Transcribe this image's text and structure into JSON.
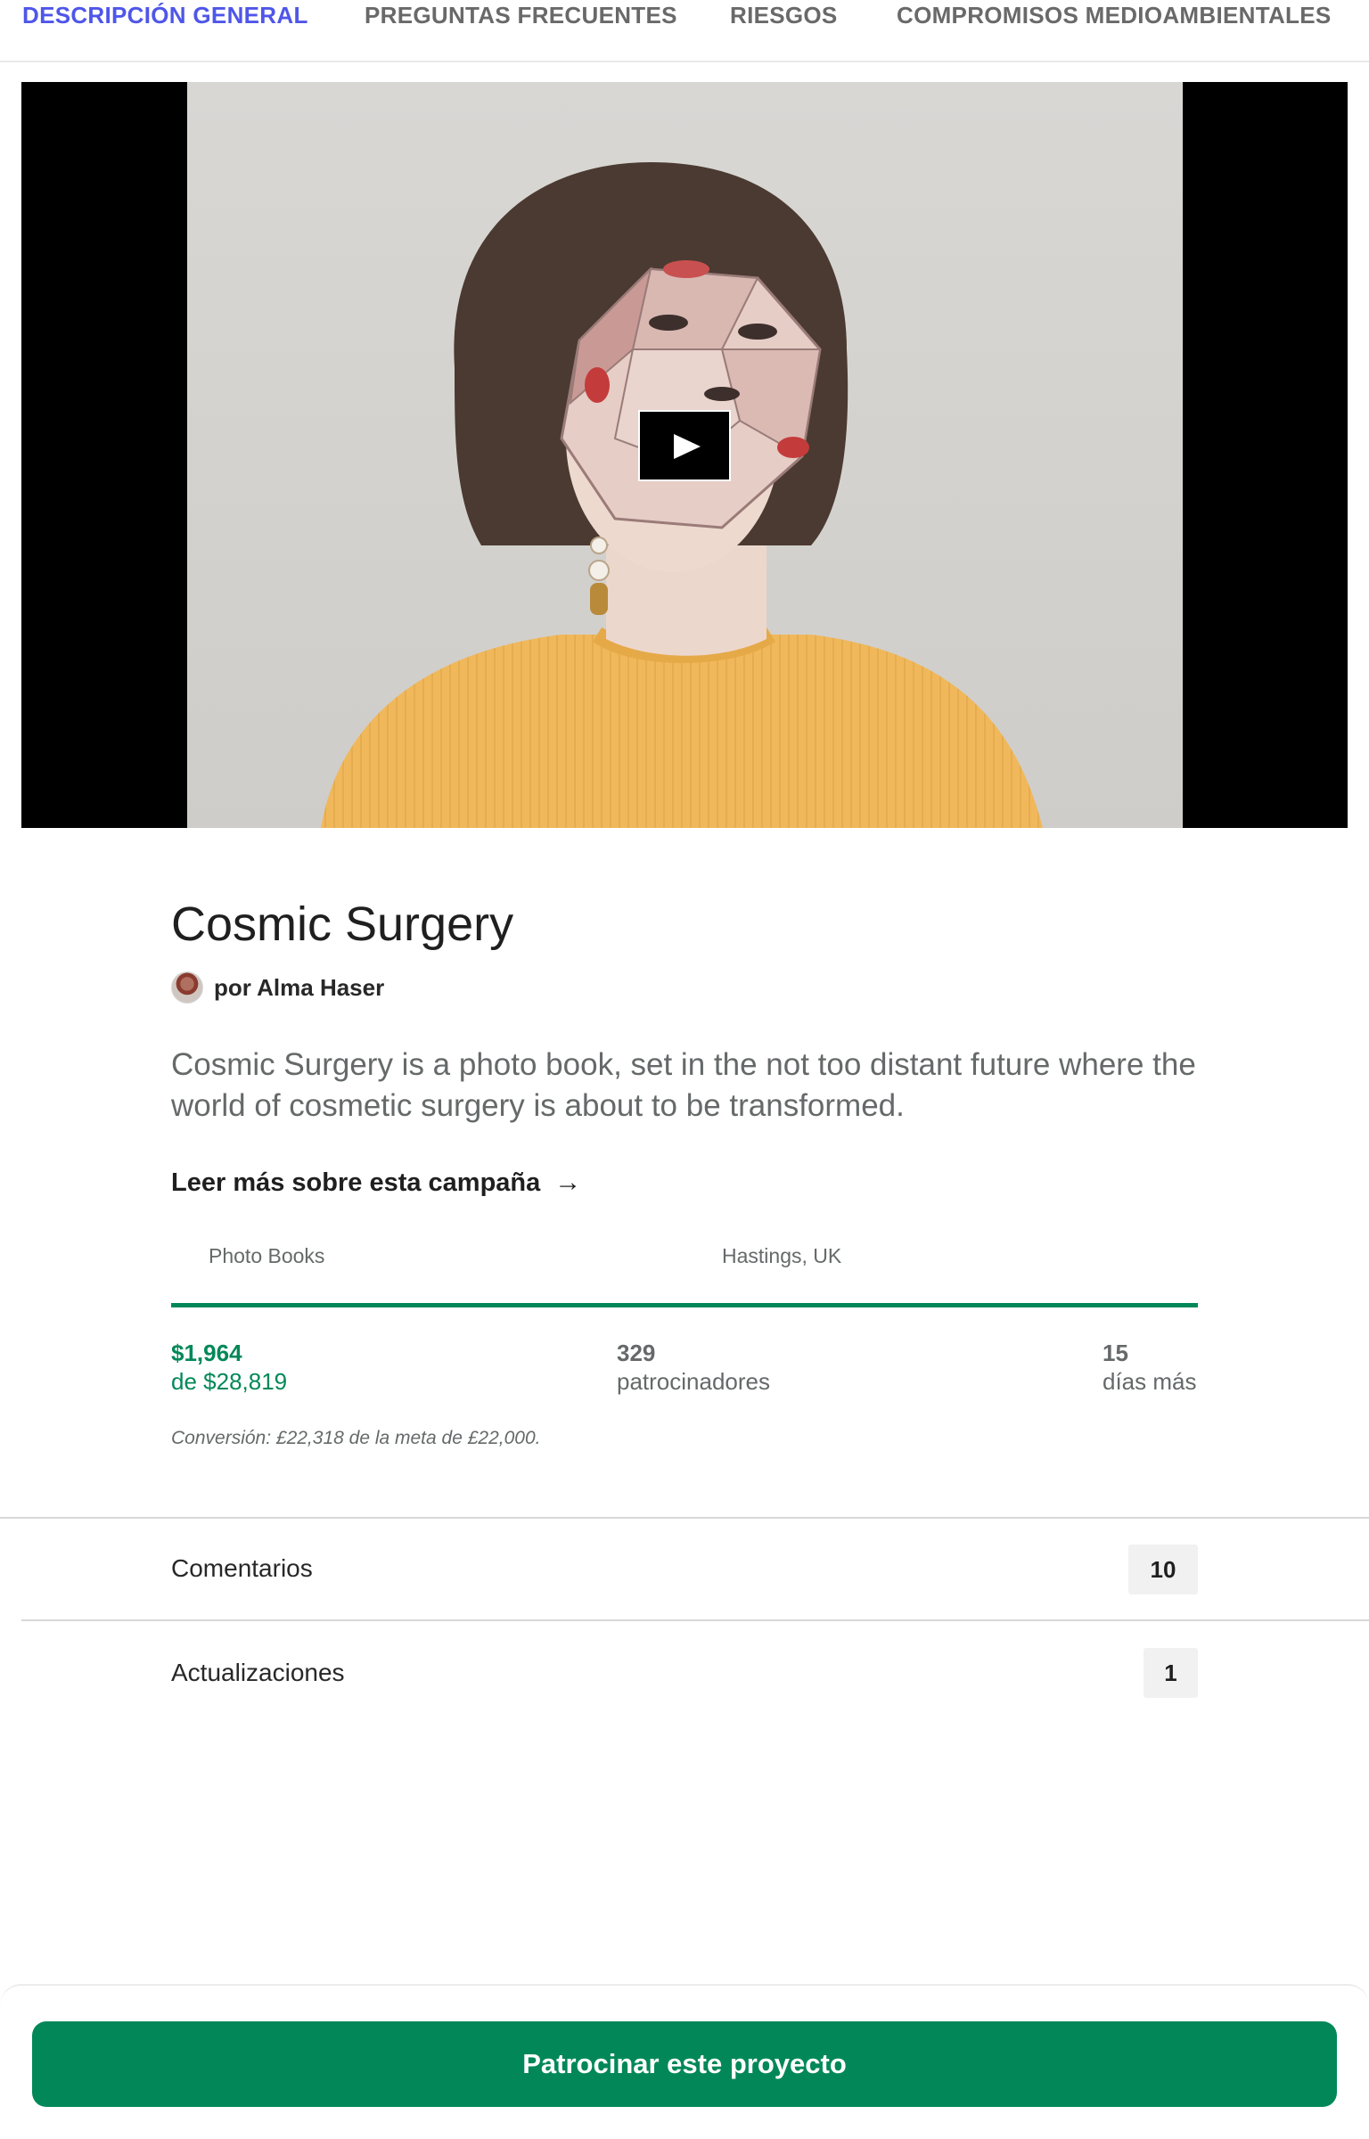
{
  "tabs": [
    {
      "label": "DESCRIPCIÓN GENERAL",
      "active": true
    },
    {
      "label": "PREGUNTAS FRECUENTES",
      "active": false
    },
    {
      "label": "RIESGOS",
      "active": false
    },
    {
      "label": "COMPROMISOS MEDIOAMBIENTALES",
      "active": false
    }
  ],
  "video": {
    "play_icon": "play-icon"
  },
  "project": {
    "title": "Cosmic Surgery",
    "creator": "por Alma Haser",
    "blurb": "Cosmic Surgery is a photo book, set in the not too distant future where the world of cosmetic surgery is about to be transformed.",
    "read_more": "Leer más sobre esta campaña",
    "read_more_icon": "→",
    "category": "Photo Books",
    "location": "Hastings, UK"
  },
  "stats": {
    "progress": 1.0,
    "pledged": "$1,964",
    "goal": "de $28,819",
    "backers_count": "329",
    "backers_label": "patrocinadores",
    "days_count": "15",
    "days_label": "días más",
    "conversion": "Conversión: £22,318 de la meta de £22,000."
  },
  "rows": {
    "comments_label": "Comentarios",
    "comments_count": "10",
    "updates_label": "Actualizaciones",
    "updates_count": "1"
  },
  "cta": {
    "label": "Patrocinar este proyecto"
  },
  "colors": {
    "accent": "#4f56e8",
    "brand_green": "#028858"
  }
}
